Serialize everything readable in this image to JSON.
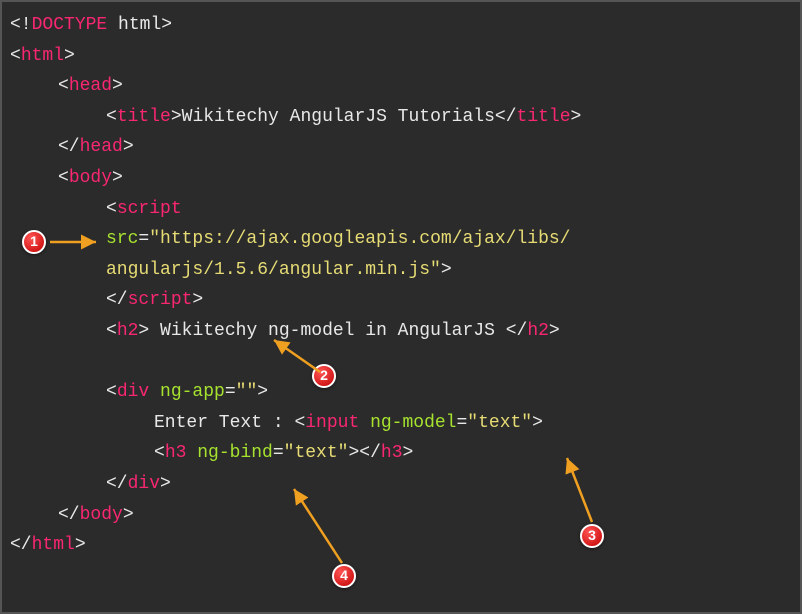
{
  "code": {
    "doctype_open": "<!",
    "doctype_tag": "DOCTYPE",
    "doctype_text": " html",
    "doctype_close": ">",
    "html_open": "<",
    "html_tag": "html",
    "html_close": ">",
    "head_open": "<",
    "head_tag": "head",
    "head_close": ">",
    "title_open": "<",
    "title_tag": "title",
    "title_close": ">",
    "title_text": "Wikitechy AngularJS Tutorials",
    "title_end_open": "</",
    "title_end_close": ">",
    "head_end_open": "</",
    "head_end_close": ">",
    "body_open": "<",
    "body_tag": "body",
    "body_close": ">",
    "script_open": "<",
    "script_tag": "script",
    "src_attr": "src",
    "src_eq": "=",
    "src_val1": "\"https://ajax.googleapis.com/ajax/libs/",
    "src_val2": "angularjs/1.5.6/angular.min.js\"",
    "script_close": ">",
    "script_end_open": "</",
    "script_end_close": ">",
    "h2_open": "<",
    "h2_tag": "h2",
    "h2_close": ">",
    "h2_text": " Wikitechy ng-model in AngularJS ",
    "h2_end_open": "</",
    "h2_end_close": ">",
    "div_open": "<",
    "div_tag": "div",
    "ngapp_attr": " ng-app",
    "ngapp_eq": "=",
    "ngapp_val": "\"\"",
    "div_close": ">",
    "enter_text": "Enter Text : ",
    "input_open": "<",
    "input_tag": "input",
    "ngmodel_attr": " ng-model",
    "ngmodel_eq": "=",
    "ngmodel_val": "\"text\"",
    "input_close": ">",
    "h3_open": "<",
    "h3_tag": "h3",
    "ngbind_attr": " ng-bind",
    "ngbind_eq": "=",
    "ngbind_val": "\"text\"",
    "h3_close": ">",
    "h3_end_open": "</",
    "h3_end_close": ">",
    "div_end_open": "</",
    "div_end_close": ">",
    "body_end_open": "</",
    "body_end_close": ">",
    "html_end_open": "</",
    "html_end_close": ">"
  },
  "badges": {
    "b1": "1",
    "b2": "2",
    "b3": "3",
    "b4": "4"
  }
}
